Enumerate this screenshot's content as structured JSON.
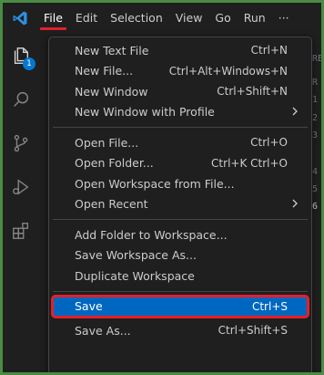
{
  "menubar": {
    "items": [
      "File",
      "Edit",
      "Selection",
      "View",
      "Go",
      "Run",
      "···"
    ]
  },
  "activity": {
    "badge": "1"
  },
  "editor": {
    "header": "RE",
    "lines": [
      "R",
      "1",
      "2",
      "3",
      "4",
      "5",
      "6"
    ]
  },
  "file_menu": {
    "groups": [
      [
        {
          "label": "New Text File",
          "shortcut": "Ctrl+N"
        },
        {
          "label": "New File...",
          "shortcut": "Ctrl+Alt+Windows+N"
        },
        {
          "label": "New Window",
          "shortcut": "Ctrl+Shift+N"
        },
        {
          "label": "New Window with Profile",
          "shortcut": "",
          "submenu": true
        }
      ],
      [
        {
          "label": "Open File...",
          "shortcut": "Ctrl+O"
        },
        {
          "label": "Open Folder...",
          "shortcut": "Ctrl+K Ctrl+O"
        },
        {
          "label": "Open Workspace from File...",
          "shortcut": ""
        },
        {
          "label": "Open Recent",
          "shortcut": "",
          "submenu": true
        }
      ],
      [
        {
          "label": "Add Folder to Workspace...",
          "shortcut": ""
        },
        {
          "label": "Save Workspace As...",
          "shortcut": ""
        },
        {
          "label": "Duplicate Workspace",
          "shortcut": ""
        }
      ],
      [
        {
          "label": "Save",
          "shortcut": "Ctrl+S",
          "highlighted": true
        },
        {
          "label": "Save As...",
          "shortcut": "Ctrl+Shift+S"
        }
      ]
    ]
  },
  "colors": {
    "accent": "#0067c0",
    "highlight_outline": "#e51f2b",
    "menu_bg": "#1f1f1f",
    "frame_border": "#4a8c44"
  }
}
